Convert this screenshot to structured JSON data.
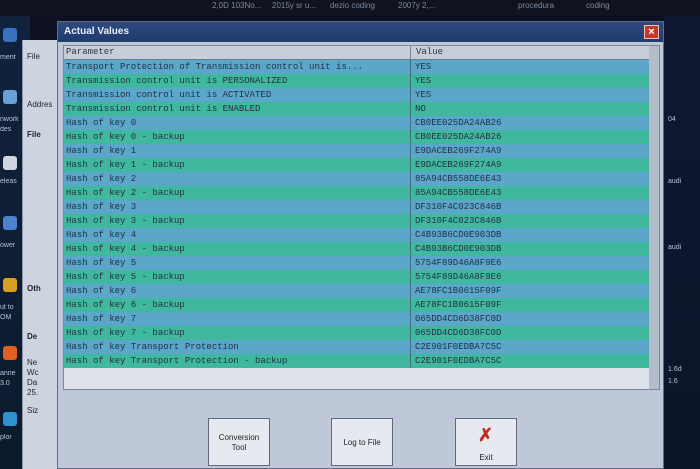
{
  "taskbar": {
    "items": [
      "2,0D 103No...",
      "2015y sr u...",
      "dezio coding",
      "2007y 2,...",
      "procedura",
      "coding"
    ]
  },
  "desktop_left": {
    "labels": [
      "ment",
      "nwork",
      "des",
      "eleas",
      "ower",
      "ut to",
      "OM",
      "anne",
      "3.0",
      "plor"
    ]
  },
  "background_window": {
    "labels": [
      "File",
      "Addres",
      "File",
      "Oth",
      "De",
      "Ne",
      "Wc",
      "Da",
      "25.",
      "Siz"
    ]
  },
  "desktop_right": {
    "labels": [
      "04",
      "audi",
      "audi",
      "1.6d",
      "1.6"
    ]
  },
  "dialog": {
    "title": "Actual Values",
    "close_symbol": "×"
  },
  "table": {
    "columns": [
      "Parameter",
      "Value"
    ],
    "rows": [
      {
        "parameter": "Transport Protection of Transmission control unit is...",
        "value": "YES"
      },
      {
        "parameter": "Transmission control unit is PERSONALIZED",
        "value": "YES"
      },
      {
        "parameter": "Transmission control unit is ACTIVATED",
        "value": "YES"
      },
      {
        "parameter": "Transmission control unit is ENABLED",
        "value": "NO"
      },
      {
        "parameter": "Hash of key 0",
        "value": "CB0EE025DA24AB26"
      },
      {
        "parameter": "Hash of key 0 - backup",
        "value": "CB0EE025DA24AB26"
      },
      {
        "parameter": "Hash of key 1",
        "value": "E9DACEB269F274A9"
      },
      {
        "parameter": "Hash of key 1 - backup",
        "value": "E9DACEB269F274A9"
      },
      {
        "parameter": "Hash of key 2",
        "value": "85A94CB558DE6E43"
      },
      {
        "parameter": "Hash of key 2 - backup",
        "value": "85A94CB558DE6E43"
      },
      {
        "parameter": "Hash of key 3",
        "value": "DF310F4C023C846B"
      },
      {
        "parameter": "Hash of key 3 - backup",
        "value": "DF310F4C023C846B"
      },
      {
        "parameter": "Hash of key 4",
        "value": "C4B93B6CD0E903DB"
      },
      {
        "parameter": "Hash of key 4 - backup",
        "value": "C4B93B6CD0E903DB"
      },
      {
        "parameter": "Hash of key 5",
        "value": "5754F89D46A8F9E6"
      },
      {
        "parameter": "Hash of key 5 - backup",
        "value": "5754F89D46A8F9E6"
      },
      {
        "parameter": "Hash of key 6",
        "value": "AE78FC1B0615F09F"
      },
      {
        "parameter": "Hash of key 6 - backup",
        "value": "AE78FC1B0615F09F"
      },
      {
        "parameter": "Hash of key 7",
        "value": "065DD4CD6D38FC0D"
      },
      {
        "parameter": "Hash of key 7 - backup",
        "value": "065DD4CD6D38FC0D"
      },
      {
        "parameter": "Hash of key Transport Protection",
        "value": "C2E901F0EDBA7C5C"
      },
      {
        "parameter": "Hash of key Transport Protection - backup",
        "value": "C2E901F0EDBA7C5C"
      }
    ]
  },
  "buttons": {
    "conversion_line1": "Conversion",
    "conversion_line2": "Tool",
    "log": "Log to File",
    "exit": "Exit",
    "exit_symbol": "✗"
  }
}
